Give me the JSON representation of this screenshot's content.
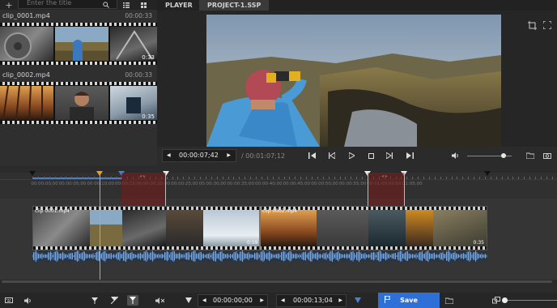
{
  "left_panel": {
    "search": {
      "placeholder": "Enter the title"
    },
    "clips": [
      {
        "name": "clip_0001.mp4",
        "duration": "00:00:33",
        "thumb_time": "0:33"
      },
      {
        "name": "clip_0002.mp4",
        "duration": "00:00:33",
        "thumb_time": "0:35"
      }
    ]
  },
  "tabs": [
    {
      "label": "PLAYER"
    },
    {
      "label": "PROJECT-1.SSP"
    }
  ],
  "player": {
    "current_time": "00:00:07;42",
    "total_time": "/ 00:01:07;12",
    "volume_level": 0.82
  },
  "timeline": {
    "ruler_labels": [
      "00:00:00;00",
      "00:00:05;00",
      "00:00:10;00",
      "00:00:15;00",
      "00:00:20;00",
      "00:00:25;00",
      "00:00:30;00",
      "00:00:35;00",
      "00:00:40;00",
      "00:00:45;00",
      "00:00:50;00",
      "00:00:55;00",
      "00:01:00;00",
      "00:01:05;00"
    ],
    "clips": [
      {
        "name": "clip 0001.mp4",
        "time": "0:59"
      },
      {
        "name": "clip 0002.mp4",
        "time": "0:35"
      }
    ]
  },
  "bottom_bar": {
    "in_time": "00:00:00;00",
    "out_time": "00:00:13;04",
    "save_label": "Save"
  },
  "colors": {
    "accent": "#2f6fd8",
    "playhead": "#f0a020",
    "cut_region": "#7a1919",
    "range": "#4a7fd6"
  }
}
